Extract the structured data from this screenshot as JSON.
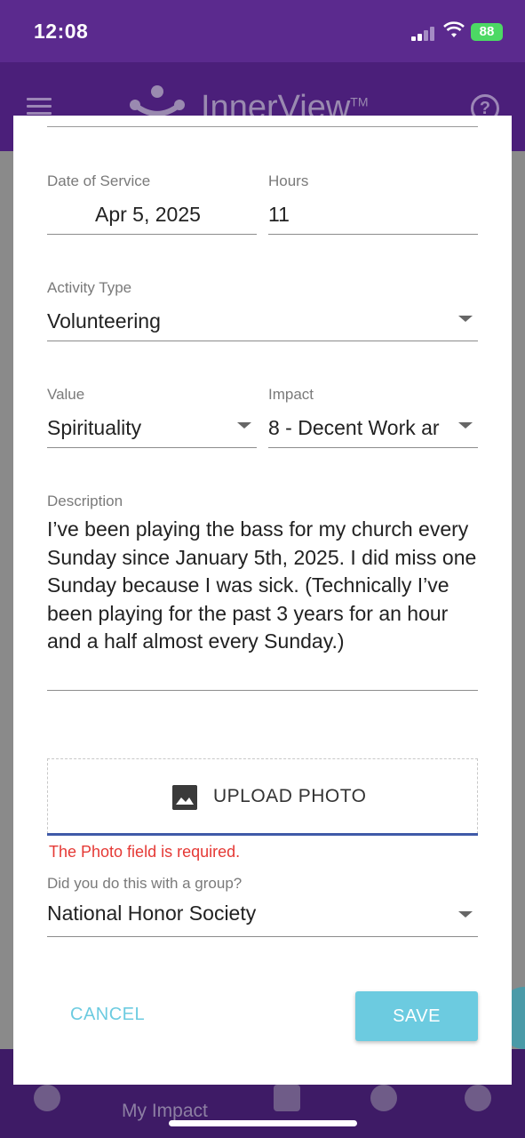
{
  "status_bar": {
    "time": "12:08",
    "battery": "88"
  },
  "app_bar": {
    "title": "InnerView",
    "trademark": "TM"
  },
  "bottom_nav": {
    "my_impact_label": "My Impact"
  },
  "form": {
    "date": {
      "label": "Date of Service",
      "value": "Apr 5, 2025"
    },
    "hours": {
      "label": "Hours",
      "value": "11"
    },
    "activity_type": {
      "label": "Activity Type",
      "value": "Volunteering"
    },
    "value": {
      "label": "Value",
      "value": "Spirituality"
    },
    "impact": {
      "label": "Impact",
      "value": "8 - Decent Work ar"
    },
    "description": {
      "label": "Description",
      "value": "I’ve been playing the bass for my church every Sunday since January 5th, 2025. I did miss one Sunday because I was sick. (Technically I’ve been playing for the past 3 years for an hour and a half almost every Sunday.)"
    },
    "upload": {
      "label": "UPLOAD PHOTO",
      "error": "The Photo field is required."
    },
    "group": {
      "label": "Did you do this with a group?",
      "value": "National Honor Society"
    }
  },
  "actions": {
    "cancel": "CANCEL",
    "save": "SAVE"
  }
}
